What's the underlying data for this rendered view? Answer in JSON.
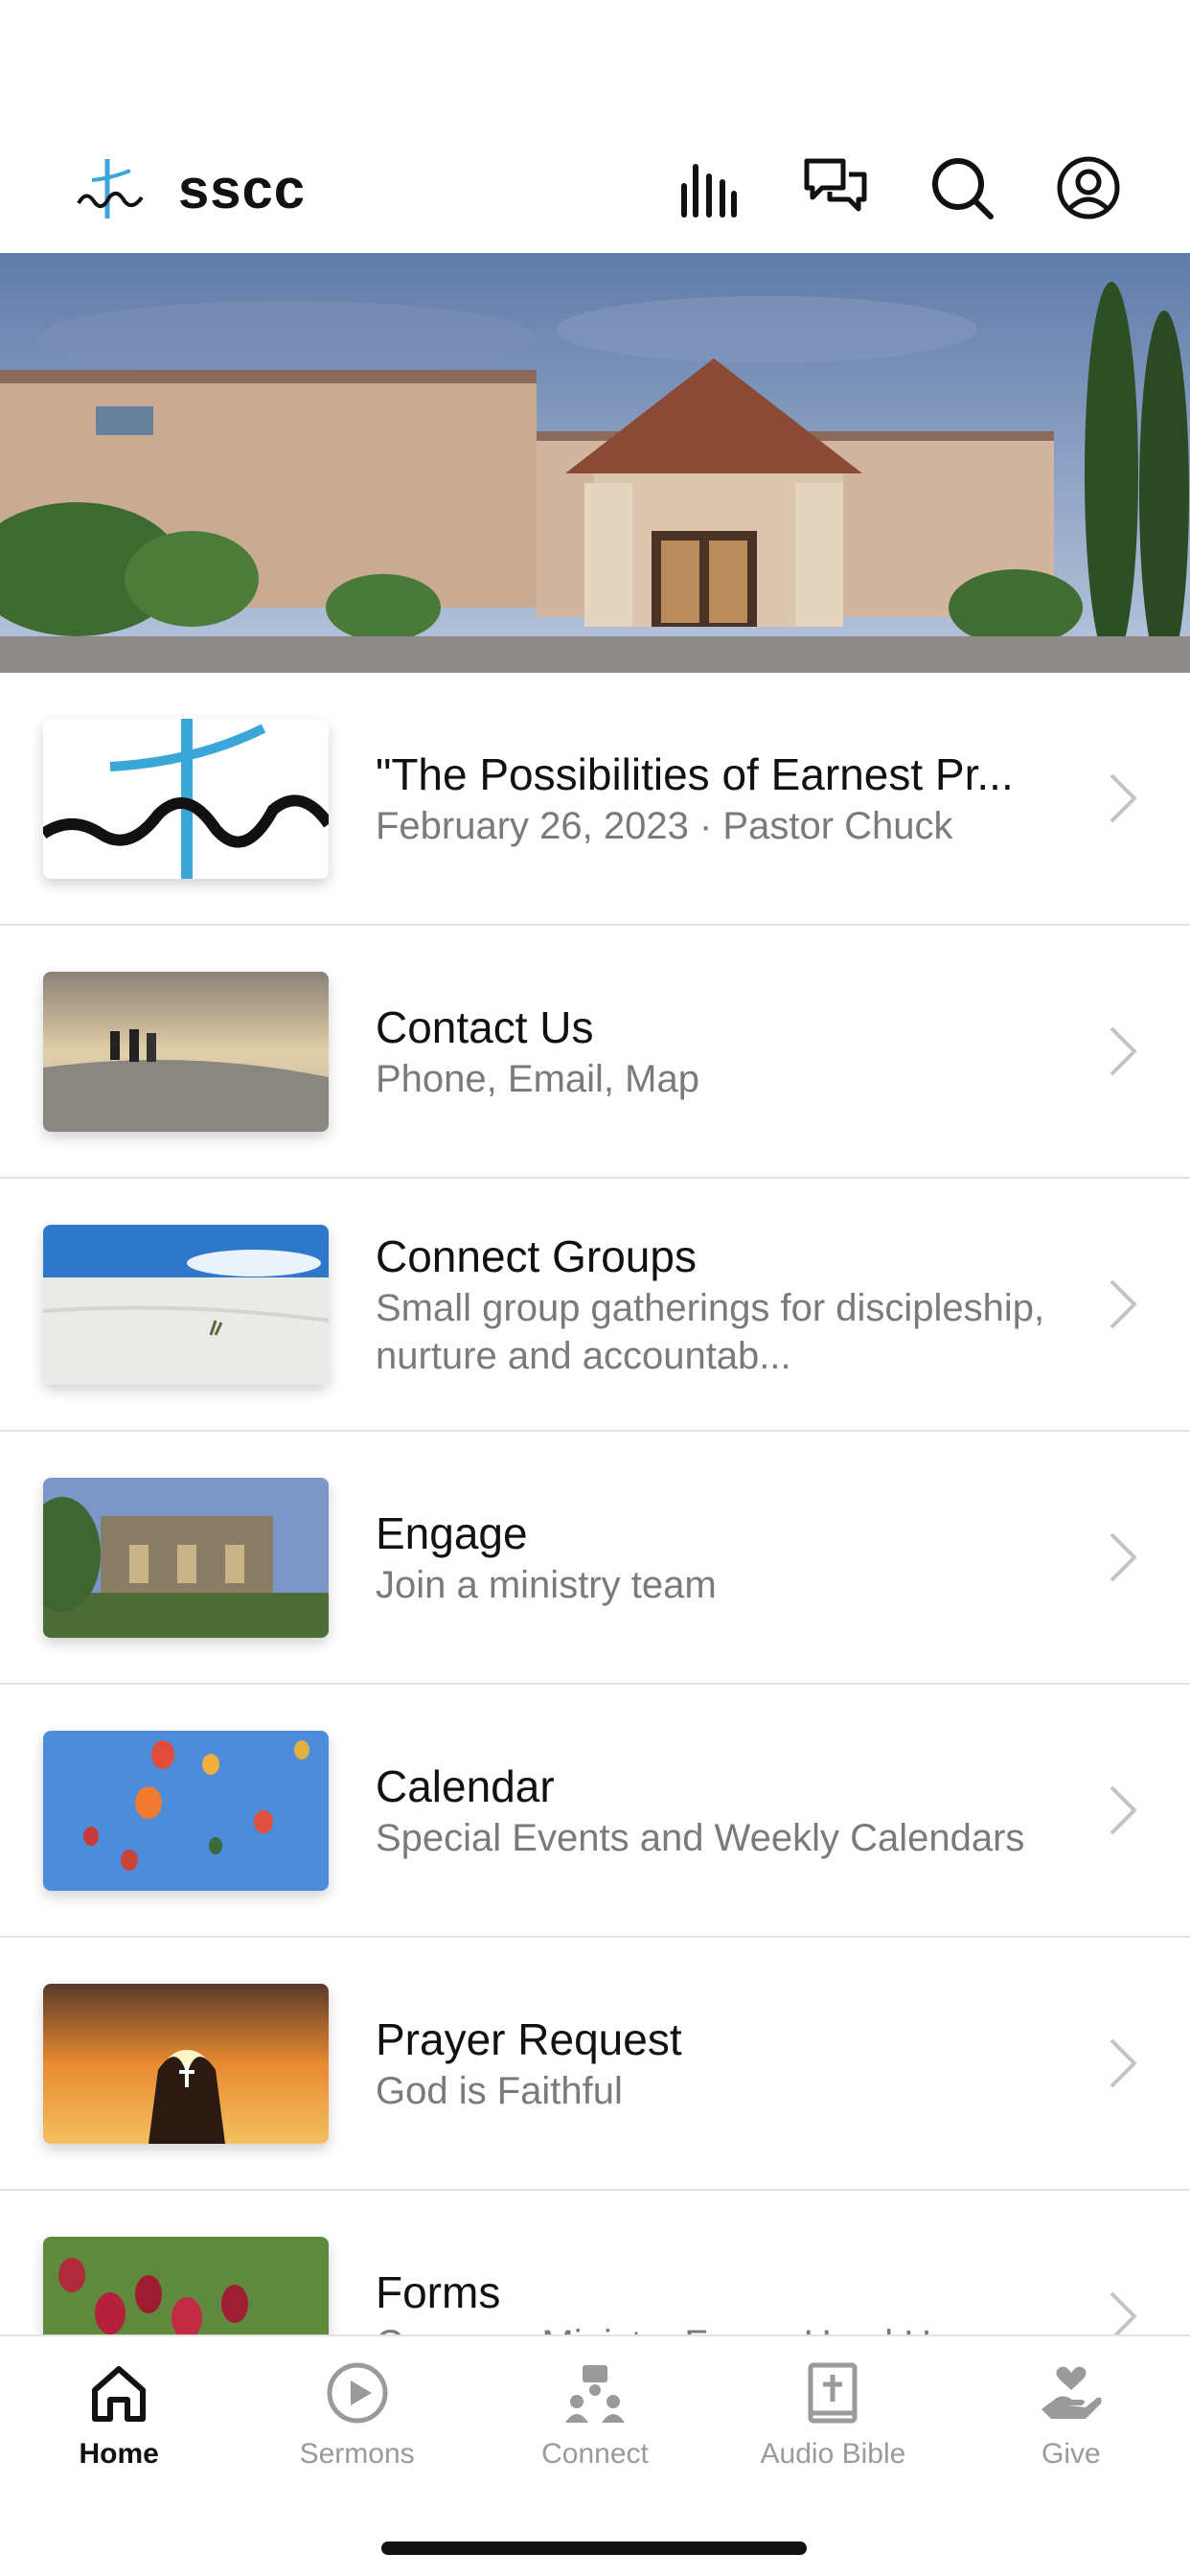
{
  "header": {
    "title": "sscc",
    "icons": [
      "stats-icon",
      "chat-icon",
      "search-icon",
      "profile-icon"
    ]
  },
  "list": {
    "items": [
      {
        "title": "\"The Possibilities of Earnest Pr...",
        "subtitle": "February 26, 2023 · Pastor Chuck",
        "thumb": "sermon-logo"
      },
      {
        "title": "Contact Us",
        "subtitle": "Phone, Email, Map",
        "thumb": "people-on-dune"
      },
      {
        "title": "Connect Groups",
        "subtitle": "Small group gatherings for discipleship, nurture and accountab...",
        "thumb": "white-sands"
      },
      {
        "title": "Engage",
        "subtitle": "Join a ministry team",
        "thumb": "ruins"
      },
      {
        "title": "Calendar",
        "subtitle": "Special Events and Weekly Calendars",
        "thumb": "balloons"
      },
      {
        "title": "Prayer Request",
        "subtitle": "God is Faithful",
        "thumb": "praying-hands"
      },
      {
        "title": "Forms",
        "subtitle": "Common Ministry Forms Used Here",
        "thumb": "cactus-fruit"
      }
    ]
  },
  "tabbar": {
    "tabs": [
      {
        "label": "Home",
        "icon": "home-icon",
        "active": true
      },
      {
        "label": "Sermons",
        "icon": "play-icon",
        "active": false
      },
      {
        "label": "Connect",
        "icon": "connect-icon",
        "active": false
      },
      {
        "label": "Audio Bible",
        "icon": "bible-icon",
        "active": false
      },
      {
        "label": "Give",
        "icon": "give-icon",
        "active": false
      }
    ]
  },
  "colors": {
    "text": "#111111",
    "subtext": "#7a7a7a",
    "inactive_tab": "#9a9a9a",
    "divider": "#e3e3e3",
    "logo_blue": "#3aa7d8"
  }
}
